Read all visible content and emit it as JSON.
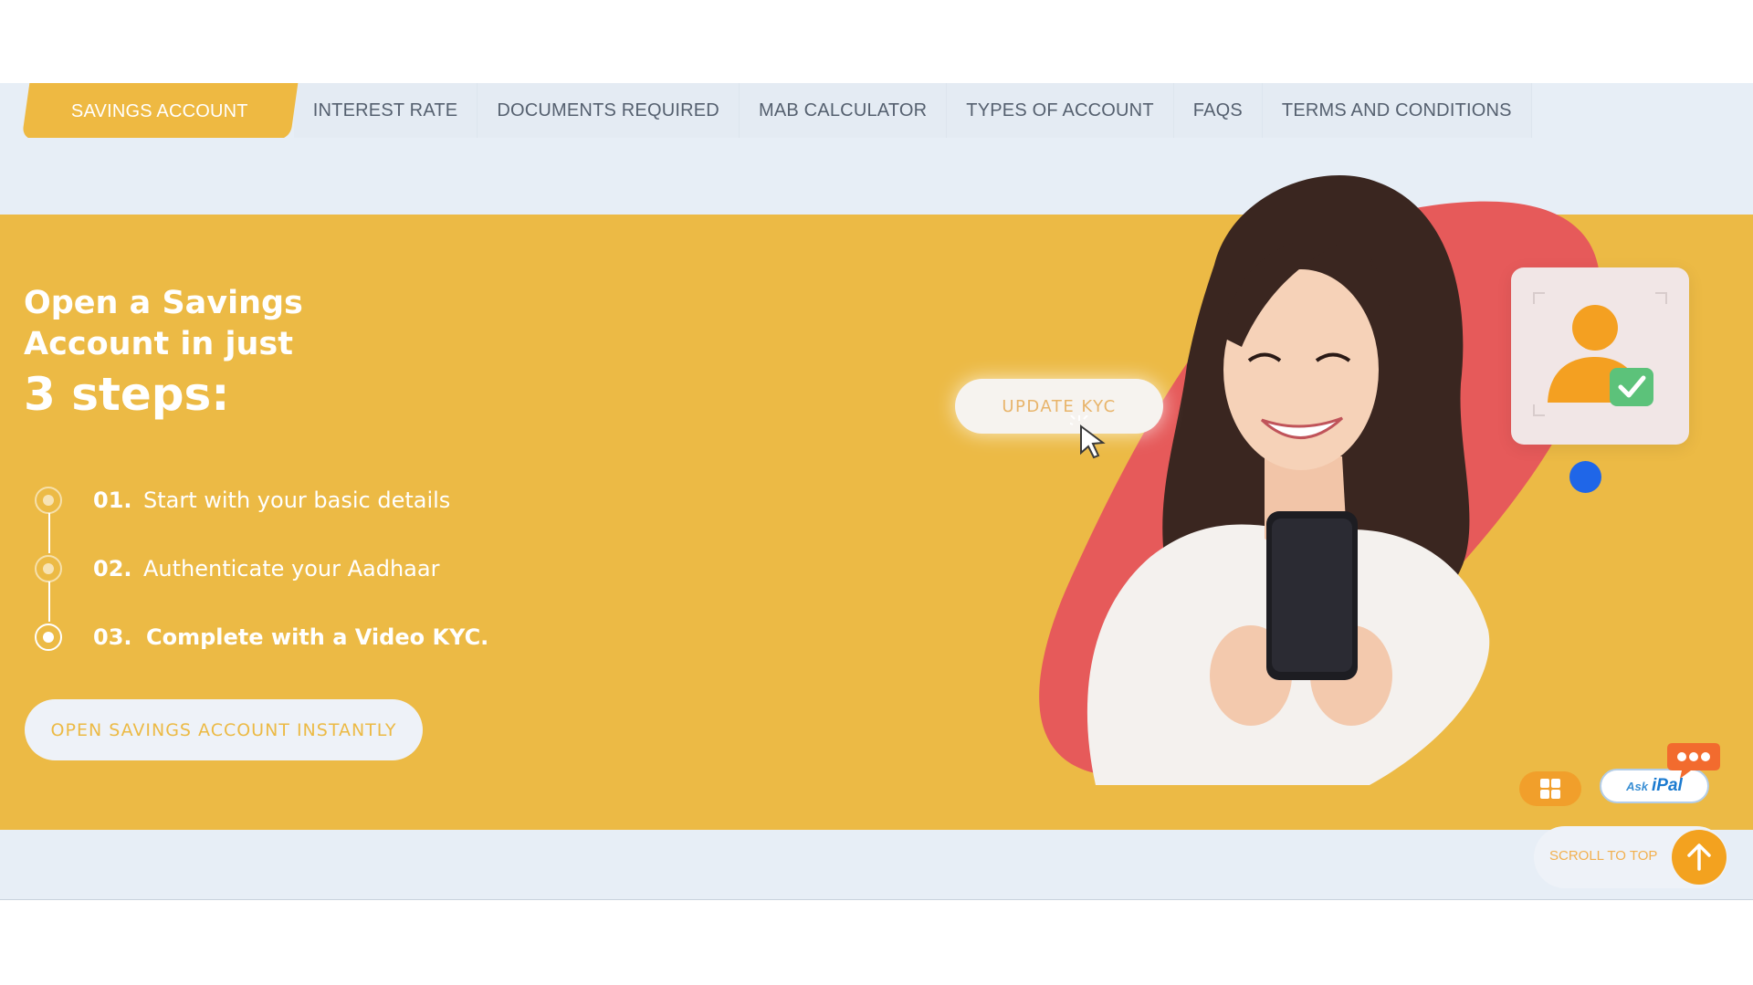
{
  "nav": {
    "tabs": [
      {
        "label": "SAVINGS ACCOUNT",
        "active": true
      },
      {
        "label": "INTEREST RATE",
        "active": false
      },
      {
        "label": "DOCUMENTS REQUIRED",
        "active": false
      },
      {
        "label": "MAB CALCULATOR",
        "active": false
      },
      {
        "label": "TYPES OF ACCOUNT",
        "active": false
      },
      {
        "label": "FAQS",
        "active": false
      },
      {
        "label": "TERMS AND CONDITIONS",
        "active": false
      }
    ]
  },
  "hero": {
    "title_line1": "Open a Savings",
    "title_line2": "Account in just",
    "title_line3": "3 steps:",
    "steps": [
      {
        "num": "01.",
        "text": "Start with your basic details"
      },
      {
        "num": "02.",
        "text": "Authenticate your Aadhaar"
      },
      {
        "num": "03.",
        "text": "Complete with a Video KYC."
      }
    ],
    "cta_label": "OPEN SAVINGS ACCOUNT INSTANTLY"
  },
  "illustration": {
    "update_kyc_label": "UPDATE KYC",
    "icons": [
      "cursor-click-icon",
      "profile-verified-icon",
      "checkmark-icon"
    ]
  },
  "widgets": {
    "askipal_ask": "Ask",
    "askipal_name": "iPal",
    "scroll_to_top_label": "SCROLL TO TOP",
    "icons": [
      "grid-apps-icon",
      "chat-bubble-icon",
      "arrow-up-icon"
    ]
  },
  "colors": {
    "brand_yellow": "#ecba45",
    "accent_orange": "#f3a21f",
    "blob_red": "#e65a5a",
    "nav_bg": "#e7eef6",
    "blue_dot": "#1f66e8"
  }
}
